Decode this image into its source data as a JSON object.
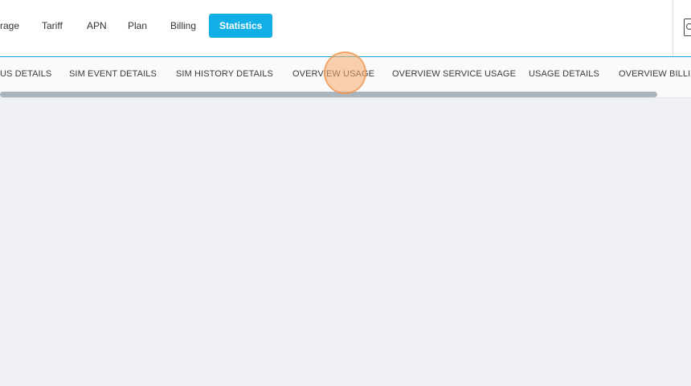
{
  "top_nav": {
    "items": [
      {
        "label": "rage"
      },
      {
        "label": "Tariff"
      },
      {
        "label": "APN"
      },
      {
        "label": "Plan"
      },
      {
        "label": "Billing"
      },
      {
        "label": "Statistics",
        "active": true
      }
    ],
    "active_color": "#12aee8"
  },
  "user_menu": {
    "icon": "user-card-icon"
  },
  "tabs": {
    "items": [
      {
        "label": "US DETAILS"
      },
      {
        "label": "SIM EVENT DETAILS"
      },
      {
        "label": "SIM HISTORY DETAILS"
      },
      {
        "label": "OVERVIEW USAGE"
      },
      {
        "label": "OVERVIEW SERVICE USAGE"
      },
      {
        "label": "USAGE DETAILS"
      },
      {
        "label": "OVERVIEW BILLIN"
      }
    ]
  }
}
